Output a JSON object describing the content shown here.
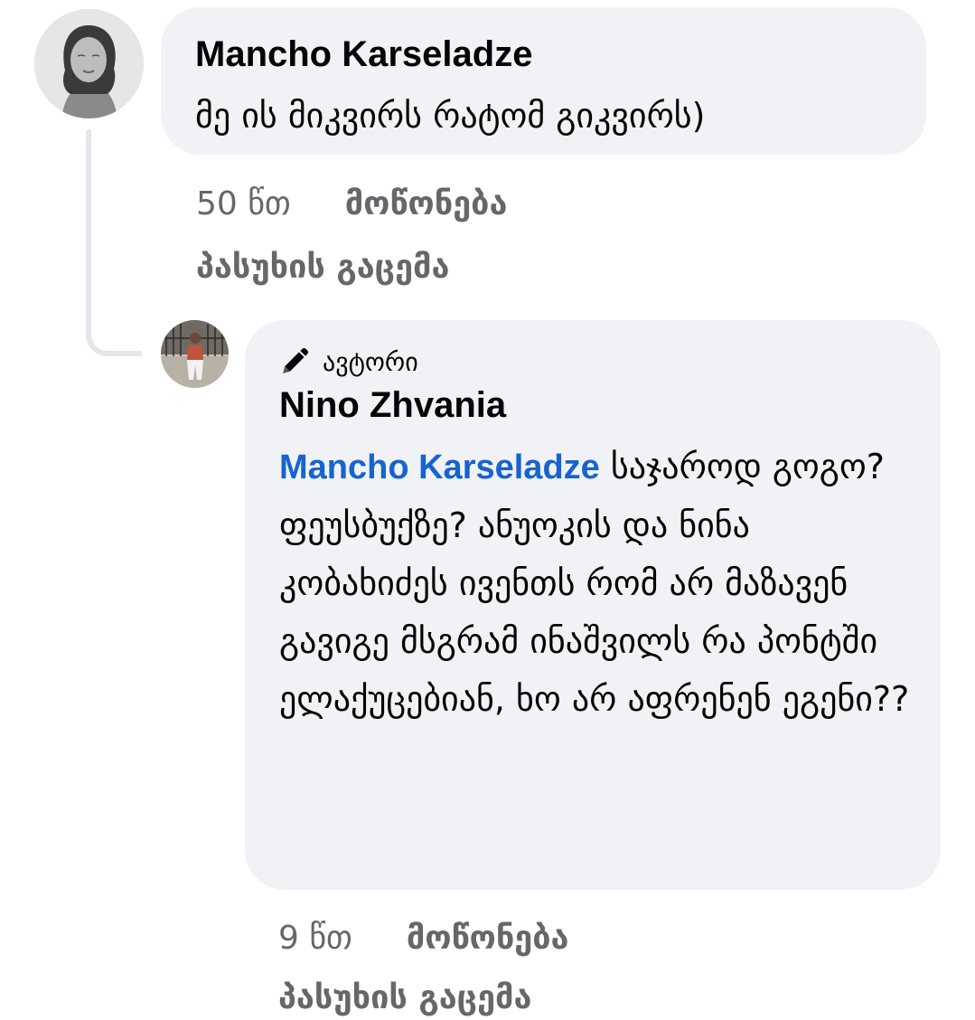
{
  "comments": [
    {
      "author": "Mancho Karseladze",
      "text": "მე ის მიკვირს რატომ გიკვირს)",
      "time": "50 წთ",
      "like_label": "მოწონება",
      "reply_label": "პასუხის გაცემა"
    },
    {
      "badge": "ავტორი",
      "author": "Nino Zhvania",
      "mention": "Mancho Karseladze",
      "text": " საჯაროდ გოგო? ფეუსბუქზე? ანუოკის და ნინა კობახიძეს ივენთს რომ არ მაზავენ გავიგე მსგრამ ინაშვილს რა პონტში ელაქუცებიან, ხო არ აფრენენ ეგენი??",
      "time": "9 წთ",
      "like_label": "მოწონება",
      "reply_label": "პასუხის გაცემა"
    }
  ],
  "icons": {
    "author_badge": "pencil-icon"
  },
  "colors": {
    "bubble_bg": "#f0f2f5",
    "mention": "#1763cf",
    "meta_text": "#65676b",
    "thread_line": "#e4e6eb"
  }
}
